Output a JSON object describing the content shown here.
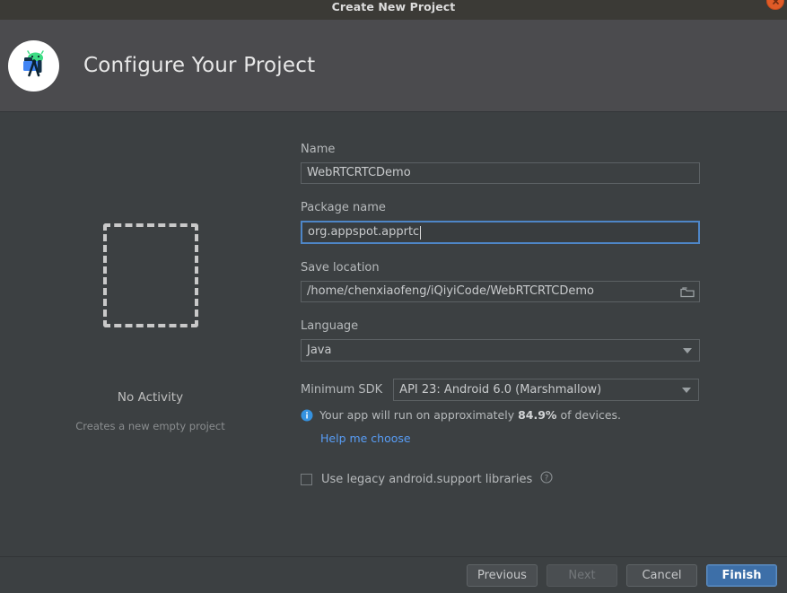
{
  "window": {
    "title": "Create New Project",
    "close_icon": "close-icon"
  },
  "header": {
    "title": "Configure Your Project",
    "logo_icon": "android-studio-logo-icon"
  },
  "preview": {
    "placeholder_icon": "dashed-square-icon",
    "title": "No Activity",
    "description": "Creates a new empty project"
  },
  "form": {
    "name": {
      "label": "Name",
      "value": "WebRTCRTCDemo"
    },
    "package_name": {
      "label": "Package name",
      "value": "org.appspot.apprtc",
      "focused": true
    },
    "save_location": {
      "label": "Save location",
      "value": "/home/chenxiaofeng/iQiyiCode/WebRTCRTCDemo",
      "browse_icon": "folder-icon"
    },
    "language": {
      "label": "Language",
      "value": "Java"
    },
    "minimum_sdk": {
      "label": "Minimum SDK",
      "value": "API 23: Android 6.0 (Marshmallow)"
    },
    "devices_note": {
      "info_icon": "info-icon",
      "text_before": "Your app will run on approximately",
      "percent": "84.9%",
      "text_after": "of devices.",
      "help_link": "Help me choose"
    },
    "legacy_libraries": {
      "label": "Use legacy android.support libraries",
      "checked": false,
      "help_icon": "question-mark-icon"
    }
  },
  "footer": {
    "previous": "Previous",
    "next": "Next",
    "cancel": "Cancel",
    "finish": "Finish"
  },
  "colors": {
    "accent_blue": "#3d6fa8",
    "link_blue": "#589df6",
    "focus_border": "#4e86c7",
    "background": "#3c4042",
    "header_background": "#4b4b4e",
    "close_button": "#e05b27"
  }
}
